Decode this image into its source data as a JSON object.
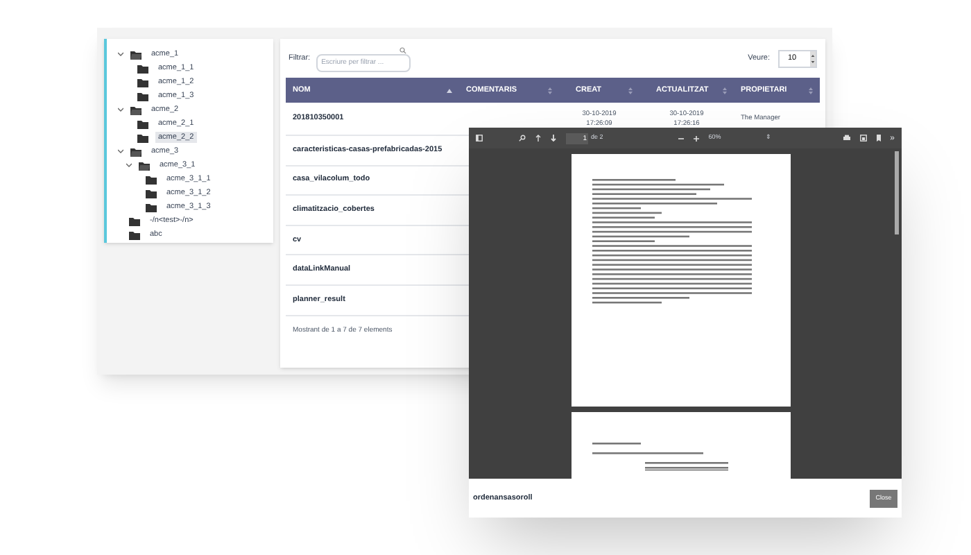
{
  "tree": [
    {
      "label": "acme_1",
      "expanded": true,
      "selected": false,
      "children": [
        {
          "label": "acme_1_1",
          "selected": false
        },
        {
          "label": "acme_1_2",
          "selected": false
        },
        {
          "label": "acme_1_3",
          "selected": false
        }
      ]
    },
    {
      "label": "acme_2",
      "expanded": true,
      "selected": false,
      "children": [
        {
          "label": "acme_2_1",
          "selected": false
        },
        {
          "label": "acme_2_2",
          "selected": true
        }
      ]
    },
    {
      "label": "acme_3",
      "expanded": true,
      "selected": false,
      "children": [
        {
          "label": "acme_3_1",
          "expanded": true,
          "selected": false,
          "children": [
            {
              "label": "acme_3_1_1",
              "selected": false
            },
            {
              "label": "acme_3_1_2",
              "selected": false
            },
            {
              "label": "acme_3_1_3",
              "selected": false
            }
          ]
        }
      ]
    },
    {
      "label": "-/n<test>-/n>",
      "selected": false
    },
    {
      "label": "abc",
      "selected": false
    }
  ],
  "filter": {
    "label": "Filtrar:",
    "placeholder": "Escriure per filtrar ..."
  },
  "page_size": {
    "label": "Veure:",
    "value": "10"
  },
  "table": {
    "columns": [
      {
        "label": "NOM",
        "sorted": true
      },
      {
        "label": "COMENTARIS",
        "sorted": false
      },
      {
        "label": "CREAT",
        "sorted": false
      },
      {
        "label": "ACTUALITZAT",
        "sorted": false
      },
      {
        "label": "PROPIETARI",
        "sorted": false
      }
    ],
    "rows": [
      [
        "201810350001",
        "",
        "30-10-2019\n17:26:09",
        "30-10-2019\n17:26:16",
        "The Manager"
      ],
      [
        "caracteristicas-casas-prefabricadas-2015"
      ],
      [
        "casa_vilacolum_todo"
      ],
      [
        "climatitzacio_cobertes"
      ],
      [
        "cv"
      ],
      [
        "dataLinkManual"
      ],
      [
        "planner_result"
      ]
    ],
    "footer": "Mostrant de 1 a 7 de 7 elements"
  },
  "viewer": {
    "page_input": "1",
    "page_count": "de 2",
    "zoom": "60%",
    "zoom_caret": "⇕",
    "more": "»",
    "file_name": "ordenansasoroll",
    "close": "Close"
  }
}
